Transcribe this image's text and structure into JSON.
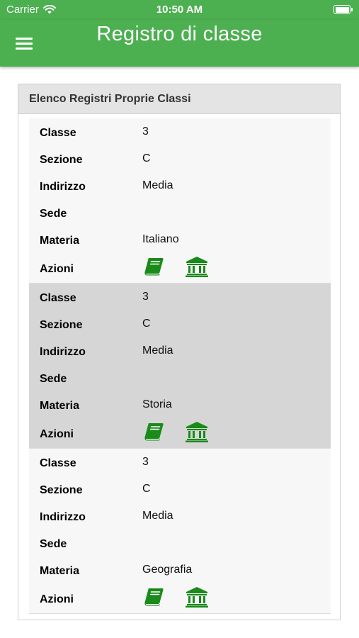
{
  "status_bar": {
    "carrier": "Carrier",
    "time": "10:50 AM",
    "wifi_icon": "wifi-icon",
    "battery_icon": "battery-icon"
  },
  "nav": {
    "title": "Registro di classe",
    "menu_icon": "hamburger-menu-icon",
    "color": "#4caf50"
  },
  "card": {
    "header": "Elenco Registri Proprie Classi",
    "labels": {
      "classe": "Classe",
      "sezione": "Sezione",
      "indirizzo": "Indirizzo",
      "sede": "Sede",
      "materia": "Materia",
      "azioni": "Azioni"
    },
    "records": [
      {
        "classe": "3",
        "sezione": "C",
        "indirizzo": "Media",
        "sede": "",
        "materia": "Italiano"
      },
      {
        "classe": "3",
        "sezione": "C",
        "indirizzo": "Media",
        "sede": "",
        "materia": "Storia"
      },
      {
        "classe": "3",
        "sezione": "C",
        "indirizzo": "Media",
        "sede": "",
        "materia": "Geografia"
      }
    ],
    "action_icons": [
      "book-icon",
      "institution-icon"
    ],
    "icon_color": "#1a8a1a"
  }
}
